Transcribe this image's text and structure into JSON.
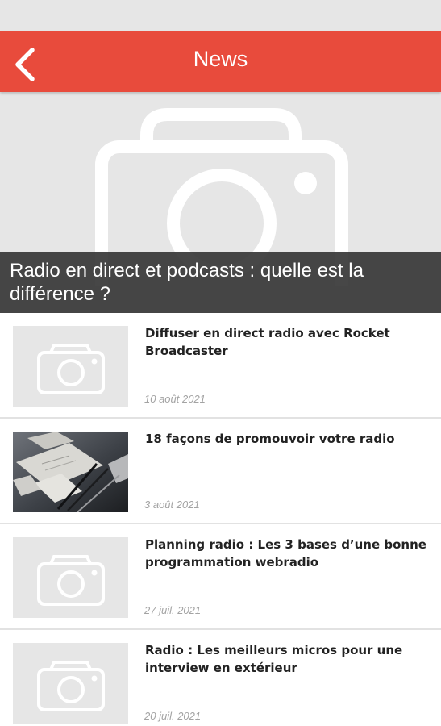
{
  "header": {
    "title": "News",
    "back_icon": "chevron-left-icon",
    "color": "#e84b3c"
  },
  "featured": {
    "title": "Radio en direct et podcasts : quelle est la différence ?",
    "image_icon": "camera-icon"
  },
  "articles": [
    {
      "title": "Diffuser en direct radio avec Rocket Broadcaster",
      "date": "10 août 2021",
      "thumbnail": "camera-placeholder-icon"
    },
    {
      "title": "18 façons de promouvoir votre radio",
      "date": "3 août 2021",
      "thumbnail": "photo"
    },
    {
      "title": "Planning radio : Les 3 bases d’une bonne programmation  webradio",
      "date": "27 juil. 2021",
      "thumbnail": "camera-placeholder-icon"
    },
    {
      "title": "Radio : Les meilleurs micros pour une interview en extérieur",
      "date": "20 juil. 2021",
      "thumbnail": "camera-placeholder-icon"
    }
  ]
}
